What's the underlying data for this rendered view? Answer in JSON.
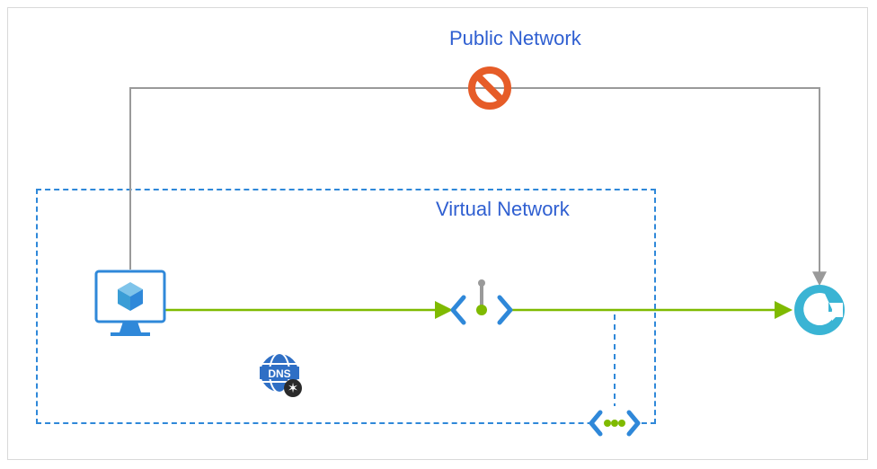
{
  "labels": {
    "public_network": "Public Network",
    "virtual_network": "Virtual Network"
  },
  "icons": {
    "vm": "vm-icon",
    "dns": "private-dns-icon",
    "private_endpoint": "private-endpoint-icon",
    "vnet_peering": "vnet-peering-icon",
    "blocked": "blocked-icon",
    "relay": "azure-relay-icon"
  },
  "arrows": {
    "public_path": {
      "from": "vm",
      "to": "relay",
      "blocked": true
    },
    "private_path_1": {
      "from": "vm",
      "to": "private-endpoint"
    },
    "private_path_2": {
      "from": "private-endpoint",
      "to": "relay"
    }
  },
  "colors": {
    "azure_blue": "#2f88d9",
    "link_blue": "#2f5fd1",
    "green": "#7fba00",
    "orange": "#e65c28",
    "teal": "#3ab4d4",
    "gray": "#9a9a9a"
  }
}
